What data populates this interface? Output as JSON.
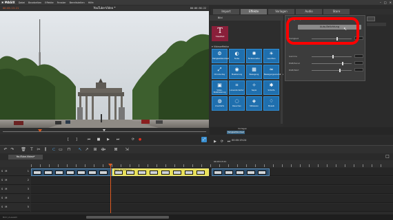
{
  "app": {
    "logo": "✖ MAGIX"
  },
  "menu": [
    "Datei",
    "Bearbeiten",
    "Effekte",
    "Fenster",
    "Bereitstellen",
    "Hilfe"
  ],
  "preview": {
    "timecode_left": "00:03:13:21",
    "title": "YouTube-Video *",
    "timecode_right": "00:06:56:22",
    "scrub_timecode": "00:00:12"
  },
  "tabs": [
    {
      "label": "Import",
      "active": false
    },
    {
      "label": "Effekte",
      "active": true
    },
    {
      "label": "Vorlagen",
      "active": false
    },
    {
      "label": "Audio",
      "active": false
    },
    {
      "label": "Store",
      "active": false
    }
  ],
  "effects": {
    "header": "Bild",
    "title_card_label": "Titeleffekt",
    "section_label": "▾ Videoeffekte",
    "tiles": [
      {
        "icon": "⚙",
        "label": "Helligkeit/Kontrast"
      },
      {
        "icon": "◐",
        "label": "Farbe"
      },
      {
        "icon": "✺",
        "label": "Farbkorrektur"
      },
      {
        "icon": "☀",
        "label": "Leuchten"
      },
      {
        "icon": "⤢",
        "label": "Chroma Key"
      },
      {
        "icon": "◉",
        "label": "Maskierung"
      },
      {
        "icon": "▦",
        "label": "Bewegung"
      },
      {
        "icon": "≈",
        "label": "Bewegungsunschärfe"
      },
      {
        "icon": "▣",
        "label": "Video-Stabilisierung"
      },
      {
        "icon": "⌗",
        "label": "Linsenkorrektur"
      },
      {
        "icon": "✧",
        "label": "Sepia"
      },
      {
        "icon": "✱",
        "label": "Schärfe"
      },
      {
        "icon": "◍",
        "label": "Unschärfe"
      },
      {
        "icon": "◌",
        "label": "Rauschen"
      },
      {
        "icon": "◈",
        "label": "Stilisieren"
      },
      {
        "icon": "♢",
        "label": "Mosaik"
      }
    ]
  },
  "settings": {
    "title": "Helligkeit / Kontrast",
    "auto_button": "Auto-Belichtung",
    "row1_label": "Helligkeit",
    "row2_label": "Gamma",
    "row3_label": "RGB/Kanal",
    "row4_label": "RGB/Wert",
    "row5_label": ""
  },
  "mini_timeline": {
    "label": "Vorlagen",
    "clip_label": "Helligkeit/Kontrast",
    "timecode": "00:00:19:24"
  },
  "timeline": {
    "tab_label": "YouTube-Video*",
    "ruler_timecode": "00:03:13:21",
    "tracks": [
      {
        "sm": "S M",
        "no": "1"
      },
      {
        "sm": "S M",
        "no": "2"
      },
      {
        "sm": "S M",
        "no": "3"
      },
      {
        "sm": "S M",
        "no": "4"
      },
      {
        "sm": "S M",
        "no": "5"
      }
    ],
    "clip_caption": "Berlin_Brandenburg",
    "status": "Bild | Auswahl"
  },
  "colors": {
    "accent_orange": "#e05a20",
    "effect_tile_blue": "#1f6fae",
    "highlight_ring": "#ff0000",
    "selected_clip": "#e8e05a"
  }
}
